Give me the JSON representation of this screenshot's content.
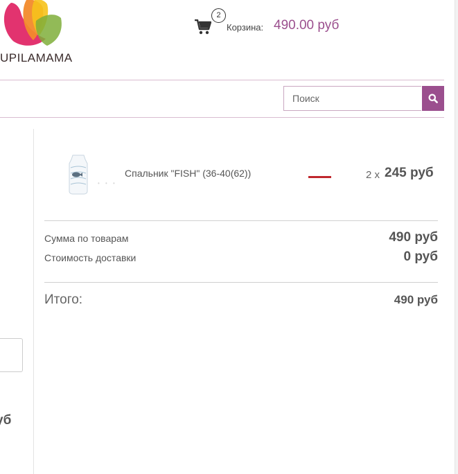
{
  "header": {
    "logo_text": "UPILAMAMA",
    "cart": {
      "count": "2",
      "label": "Корзина:",
      "total": "490.00 руб"
    },
    "search": {
      "placeholder": "Поиск"
    }
  },
  "left_column": {
    "price_fragment": "уб"
  },
  "cart_panel": {
    "items": [
      {
        "name": "Спальник \"FISH\" (36-40(62))",
        "quantity": "2 x",
        "price": "245 руб"
      }
    ],
    "summary": {
      "goods_label": "Сумма по товарам",
      "goods_value": "490 руб",
      "delivery_label": "Стоимость доставки",
      "delivery_value": "0 руб",
      "total_label": "Итого:",
      "total_value": "490 руб"
    }
  },
  "colors": {
    "accent": "#9b4f8e",
    "remove": "#c0272d",
    "divider": "#d9bcd0"
  },
  "icons": [
    "logo-petals-icon",
    "cart-icon",
    "search-icon",
    "product-thumbnail",
    "remove-dash-icon"
  ]
}
